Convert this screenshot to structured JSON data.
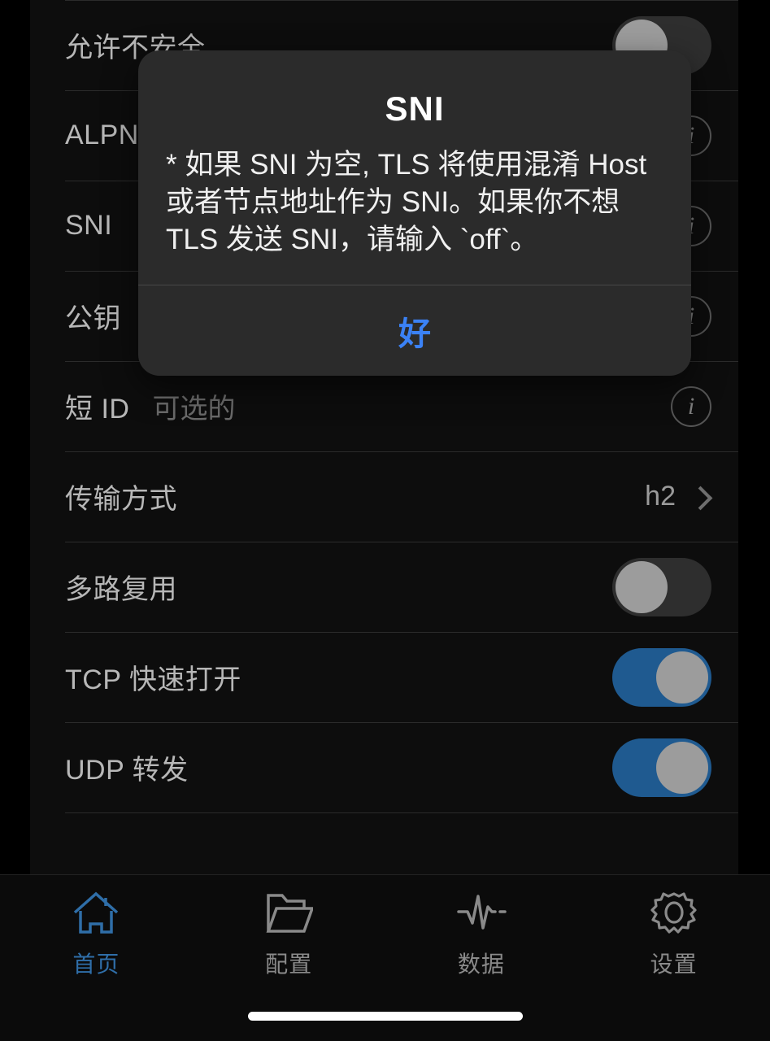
{
  "theme": {
    "background": "#000000",
    "content_background": "#0d0d0d",
    "separator": "#2b2b2b",
    "label_color": "#b7b7b7",
    "placeholder_color": "#6a6a6a",
    "accent_blue": "#3b82f6",
    "tab_active_color": "#2f6ea8",
    "toggle_on_color": "#1f5a90",
    "toggle_off_color": "#2e2e2e",
    "dialog_background": "#2b2b2b"
  },
  "settings_list": {
    "rows": [
      {
        "label": "允许不安全",
        "type": "toggle",
        "toggle_state": "off",
        "accessory": "toggle"
      },
      {
        "label": "ALPN",
        "type": "input",
        "accessory": "info-icon",
        "icon_name": "info-circle-icon"
      },
      {
        "label": "SNI",
        "type": "input",
        "accessory": "info-icon",
        "icon_name": "info-circle-icon"
      },
      {
        "label": "公钥",
        "type": "input",
        "accessory": "info-icon",
        "icon_name": "info-circle-icon"
      },
      {
        "label": "短 ID",
        "placeholder": "可选的",
        "type": "input",
        "accessory": "info-icon",
        "icon_name": "info-circle-icon"
      },
      {
        "label": "传输方式",
        "value": "h2",
        "type": "navigation",
        "accessory": "chevron",
        "icon_name": "chevron-right-icon"
      },
      {
        "label": "多路复用",
        "type": "toggle",
        "toggle_state": "off",
        "accessory": "toggle"
      },
      {
        "label": "TCP 快速打开",
        "type": "toggle",
        "toggle_state": "on",
        "accessory": "toggle"
      },
      {
        "label": "UDP 转发",
        "type": "toggle",
        "toggle_state": "on",
        "accessory": "toggle"
      }
    ]
  },
  "dialog": {
    "title": "SNI",
    "message": "* 如果 SNI 为空, TLS 将使用混淆 Host 或者节点地址作为 SNI。如果你不想 TLS 发送 SNI，请输入 `off`。",
    "action_label": "好"
  },
  "tabbar": {
    "items": [
      {
        "label": "首页",
        "icon_name": "home-icon",
        "active": true
      },
      {
        "label": "配置",
        "icon_name": "folder-icon",
        "active": false
      },
      {
        "label": "数据",
        "icon_name": "pulse-waveform-icon",
        "active": false
      },
      {
        "label": "设置",
        "icon_name": "gear-icon",
        "active": false
      }
    ]
  }
}
